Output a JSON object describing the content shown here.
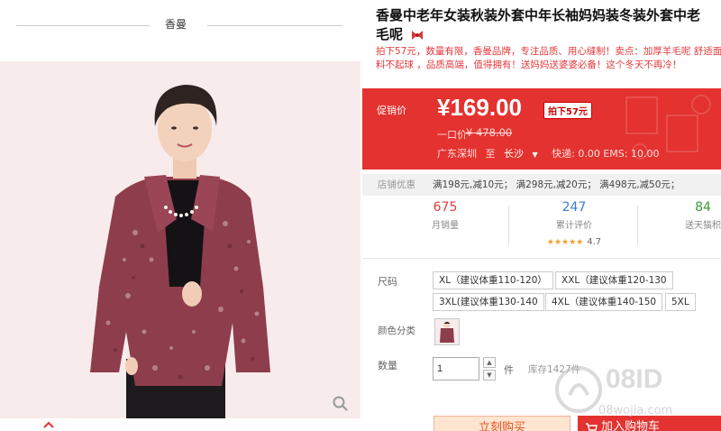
{
  "store": {
    "name": "香曼"
  },
  "product": {
    "title_line1": "香曼中老年女装秋装外套中年长袖妈妈装冬装外套中老",
    "title_line2": "毛呢",
    "subtitle": "拍下57元，数量有限，香曼品牌，专注品质、用心缝制！卖点：加厚羊毛呢 舒适面料不起球 ，品质高端，值得拥有！送妈妈送婆婆必备！这个冬天不再冷！"
  },
  "price": {
    "promo_label": "促销价",
    "value": "¥169.00",
    "badge": "拍下57元",
    "orig_label": "一口价",
    "orig_value": "¥ 478.00",
    "ship_from": "广东深圳",
    "ship_to_word": "至",
    "ship_city": "长沙",
    "ship_fees": "快递: 0.00 EMS: 10.00"
  },
  "coupon": {
    "label": "店铺优惠",
    "text": "满198元,减10元； 满298元,减20元； 满498元,减50元；"
  },
  "stats": {
    "sales_num": "675",
    "sales_label": "月销量",
    "reviews_num": "247",
    "reviews_label": "累计评价",
    "rating_stars": "★★★★★",
    "rating": "4.7",
    "points_num": "84",
    "points_label": "送天猫积"
  },
  "sku": {
    "size_label": "尺码",
    "sizes": [
      "XL（建议体重110-120）",
      "XXL（建议体重120-130",
      "3XL(建议体重130-140",
      "4XL（建议体重140-150",
      "5XL"
    ],
    "color_label": "颜色分类",
    "qty_label": "数量",
    "qty_value": "1",
    "qty_unit": "件",
    "stock": "库存1427件"
  },
  "actions": {
    "buy_label": "立刻购买",
    "cart_label": "加入购物车"
  },
  "watermark": {
    "text": "08ID",
    "sub": "08wojia.com"
  },
  "colors": {
    "accent": "#e3322f",
    "promo_text": "#e4393c"
  }
}
